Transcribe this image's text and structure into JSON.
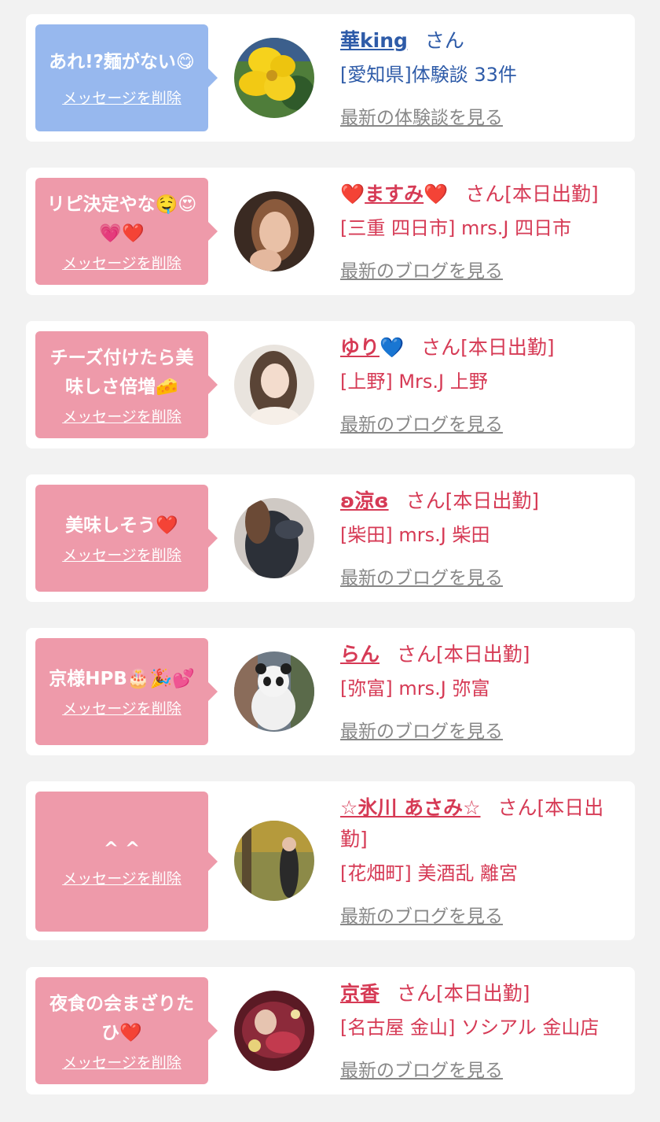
{
  "colors": {
    "bubble_blue": "#97b8ee",
    "bubble_pink": "#ee9aaa",
    "name_blue": "#2e5ba8",
    "name_red": "#d63a55",
    "link_gray": "#888888",
    "background": "#f2f2f2"
  },
  "delete_label": "メッセージを削除",
  "entries": [
    {
      "message": "あれ!?麺がない😋",
      "name": "華king",
      "suffix": "さん",
      "store": "[愛知県]体験談 33件",
      "link": "最新の体験談を見る"
    },
    {
      "message": "リピ決定やな🤤😍💗❤️",
      "name_prefix": "❤️",
      "name": "ますみ",
      "name_suffix_icon": "❤️",
      "suffix": "さん[本日出勤]",
      "store": "[三重 四日市] mrs.J 四日市",
      "link": "最新のブログを見る"
    },
    {
      "message": "チーズ付けたら美味しさ倍増🧀",
      "name": "ゆり",
      "name_suffix_icon": "💙",
      "suffix": "さん[本日出勤]",
      "store": "[上野] Mrs.J 上野",
      "link": "最新のブログを見る"
    },
    {
      "message": "美味しそう❤️",
      "name": "ʚ涼ɞ",
      "suffix": "さん[本日出勤]",
      "store": "[柴田] mrs.J 柴田",
      "link": "最新のブログを見る"
    },
    {
      "message": "京様HPB🎂🎉💕",
      "name": "らん",
      "suffix": "さん[本日出勤]",
      "store": "[弥富] mrs.J 弥富",
      "link": "最新のブログを見る"
    },
    {
      "message": "^ ^",
      "name": "☆氷川 あさみ☆",
      "suffix": "さん[本日出勤]",
      "store": "[花畑町] 美酒乱 離宮",
      "link": "最新のブログを見る"
    },
    {
      "message": "夜食の会まざりたひ❤️",
      "name": "京香",
      "suffix": "さん[本日出勤]",
      "store": "[名古屋 金山] ソシアル 金山店",
      "link": "最新のブログを見る"
    }
  ]
}
